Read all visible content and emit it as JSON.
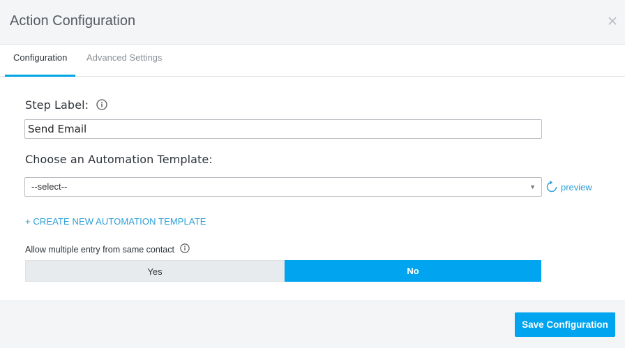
{
  "header": {
    "title": "Action Configuration",
    "close_icon": "close-icon"
  },
  "tabs": [
    {
      "label": "Configuration",
      "active": true
    },
    {
      "label": "Advanced Settings",
      "active": false
    }
  ],
  "step_label": {
    "label": "Step Label:",
    "value": "Send Email",
    "info_icon": "info-icon"
  },
  "template": {
    "label": "Choose an Automation Template:",
    "selected": "--select--",
    "preview_label": "preview",
    "refresh_icon": "refresh-icon"
  },
  "create_link": "+ CREATE NEW AUTOMATION TEMPLATE",
  "multiple_entry": {
    "label": "Allow multiple entry from same contact",
    "options": [
      "Yes",
      "No"
    ],
    "selected": "No"
  },
  "footer": {
    "save_label": "Save Configuration"
  },
  "colors": {
    "accent": "#00a4ef",
    "link": "#2a9fd8",
    "panel_bg": "#f4f5f7"
  }
}
